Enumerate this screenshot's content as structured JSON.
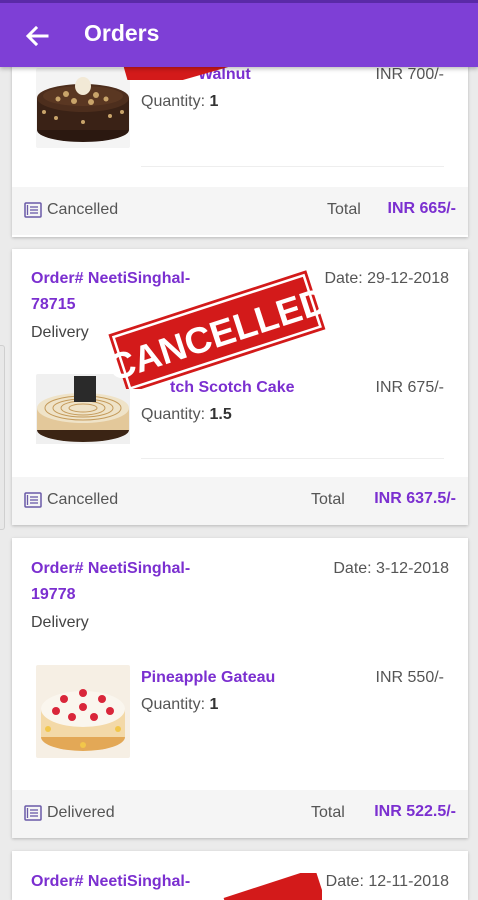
{
  "header": {
    "title": "Orders"
  },
  "orders": [
    {
      "product_name": "Walnut",
      "price": "INR 700/-",
      "qty_label": "Quantity:",
      "qty_value": "1",
      "status": "Cancelled",
      "total_label": "Total",
      "total": "INR 665/-"
    },
    {
      "order_no": "Order# NeetiSinghal-78715",
      "date": "Date: 29-12-2018",
      "type": "Delivery",
      "product_name": "tch Scotch Cake",
      "price": "INR 675/-",
      "qty_label": "Quantity:",
      "qty_value": "1.5",
      "status": "Cancelled",
      "total_label": "Total",
      "total": "INR 637.5/-",
      "stamp": "CANCELLED"
    },
    {
      "order_no": "Order# NeetiSinghal-19778",
      "date": "Date: 3-12-2018",
      "type": "Delivery",
      "product_name": "Pineapple Gateau",
      "price": "INR 550/-",
      "qty_label": "Quantity:",
      "qty_value": "1",
      "status": "Delivered",
      "total_label": "Total",
      "total": "INR 522.5/-"
    },
    {
      "order_no": "Order# NeetiSinghal-",
      "date": "Date: 12-11-2018"
    }
  ],
  "icons": {
    "back": "arrow-back-icon",
    "status": "receipt-icon"
  },
  "colors": {
    "primary": "#7e3fd6",
    "accent_text": "#7b2fd0",
    "stamp": "#d31a1a"
  }
}
